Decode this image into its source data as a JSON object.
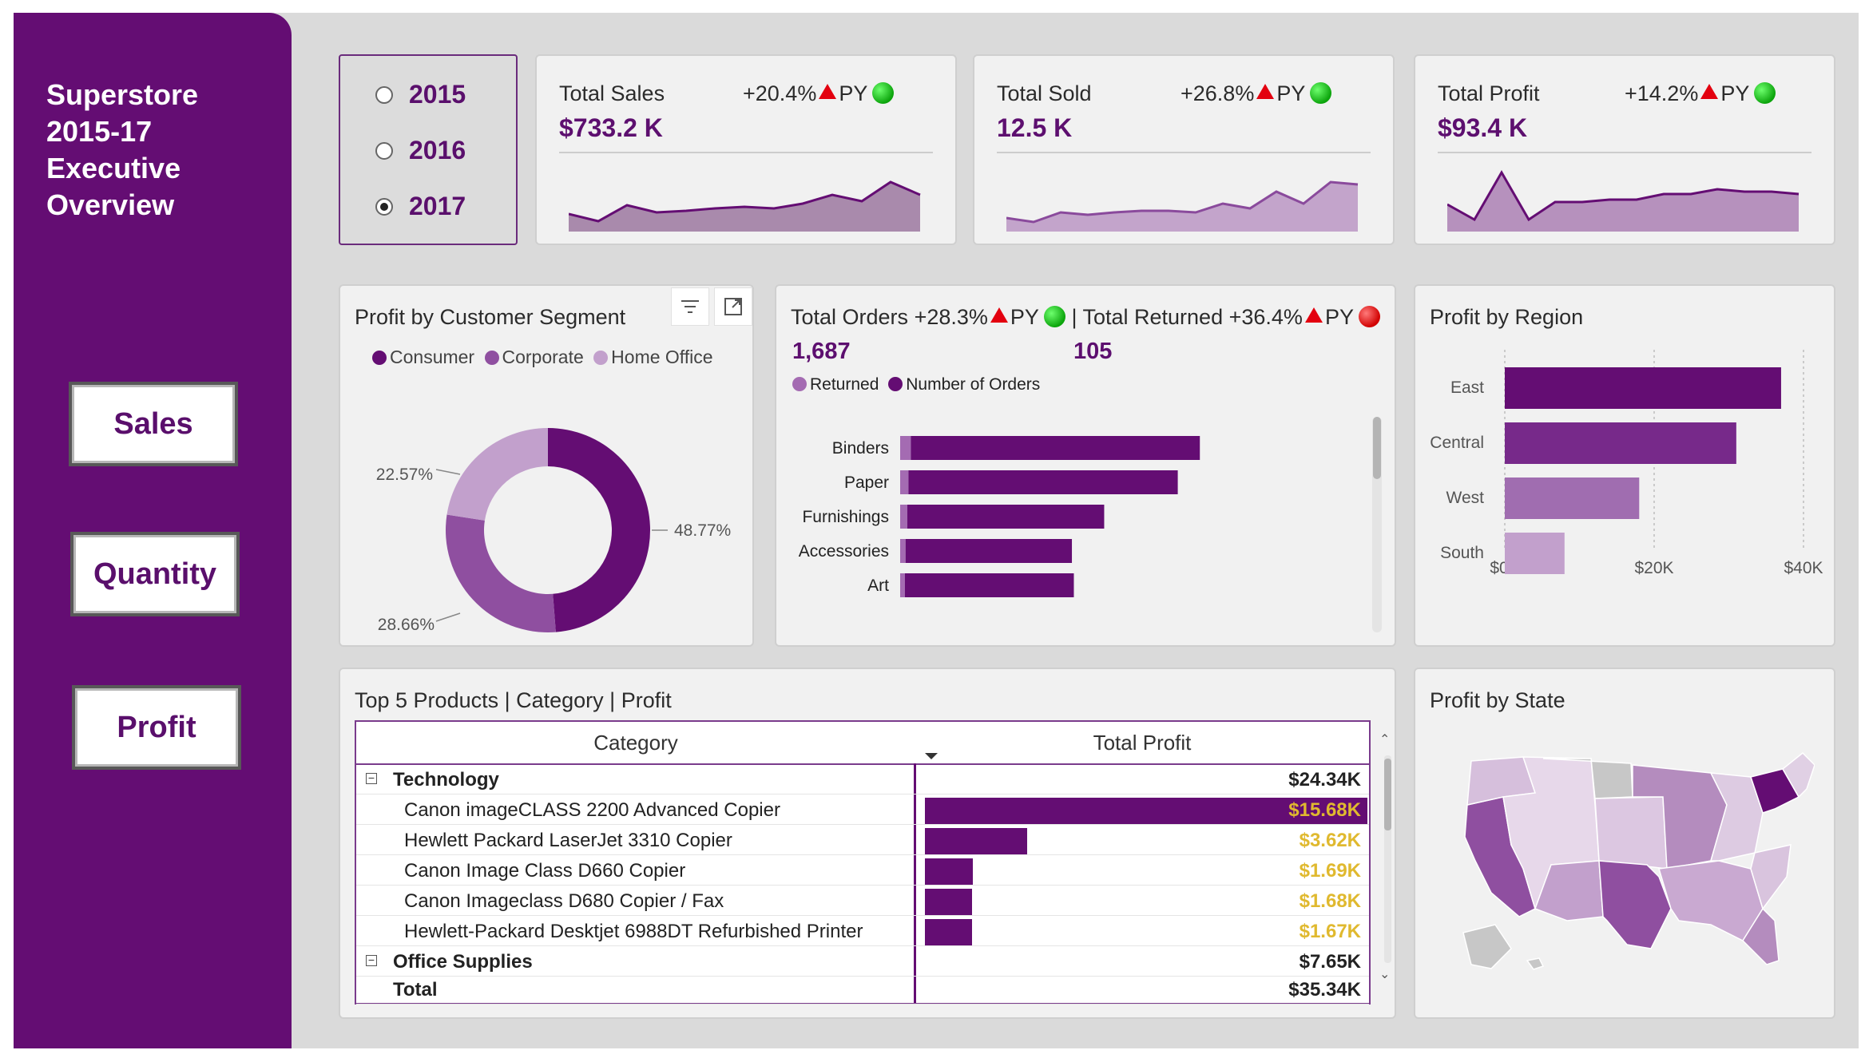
{
  "sidebar": {
    "title_lines": [
      "Superstore",
      "2015-17",
      "Executive",
      "Overview"
    ],
    "nav": [
      "Sales",
      "Quantity",
      "Profit"
    ]
  },
  "year_filter": {
    "options": [
      "2015",
      "2016",
      "2017"
    ],
    "selected": "2017"
  },
  "kpis": [
    {
      "label": "Total Sales",
      "value": "$733.2 K",
      "delta": "+20.4%",
      "suffix": "PY",
      "status": "green"
    },
    {
      "label": "Total Sold",
      "value": "12.5 K",
      "delta": "+26.8%",
      "suffix": "PY",
      "status": "green"
    },
    {
      "label": "Total Profit",
      "value": "$93.4 K",
      "delta": "+14.2%",
      "suffix": "PY",
      "status": "green"
    }
  ],
  "segment": {
    "title": "Profit by Customer Segment",
    "legend": [
      "Consumer",
      "Corporate",
      "Home Office"
    ],
    "labels": [
      "48.77%",
      "28.66%",
      "22.57%"
    ]
  },
  "orders": {
    "orders_label": "Total Orders",
    "orders_delta": "+28.3%",
    "orders_suffix": "PY",
    "separator": "|",
    "returned_label": "Total Returned",
    "returned_delta": "+36.4%",
    "returned_suffix": "PY",
    "orders_value": "1,687",
    "returned_value": "105",
    "legend": [
      "Returned",
      "Number of Orders"
    ],
    "categories": [
      "Binders",
      "Paper",
      "Furnishings",
      "Accessories",
      "Art"
    ]
  },
  "region": {
    "title": "Profit by Region",
    "categories": [
      "East",
      "Central",
      "West",
      "South"
    ],
    "ticks": [
      "$0K",
      "$20K",
      "$40K"
    ]
  },
  "top5": {
    "title": "Top 5 Products | Category | Profit",
    "col1": "Category",
    "col2": "Total Profit",
    "rows": [
      {
        "name": "Technology",
        "value": "$24.34K",
        "group": true
      },
      {
        "name": "Canon imageCLASS 2200 Advanced Copier",
        "value": "$15.68K"
      },
      {
        "name": "Hewlett Packard LaserJet 3310 Copier",
        "value": "$3.62K"
      },
      {
        "name": "Canon Image Class D660 Copier",
        "value": "$1.69K"
      },
      {
        "name": "Canon Imageclass D680 Copier / Fax",
        "value": "$1.68K"
      },
      {
        "name": "Hewlett-Packard Desktjet 6988DT Refurbished Printer",
        "value": "$1.67K"
      },
      {
        "name": "Office Supplies",
        "value": "$7.65K",
        "group": true
      },
      {
        "name": "Total",
        "value": "$35.34K",
        "total": true
      }
    ]
  },
  "state": {
    "title": "Profit by State"
  },
  "colors": {
    "brand": "#640d73",
    "mid": "#8f4fa0",
    "light": "#c2a0cc",
    "bg": "#dadada",
    "gold": "#e0b92f"
  },
  "chart_data": [
    {
      "type": "pie",
      "title": "Profit by Customer Segment",
      "categories": [
        "Consumer",
        "Corporate",
        "Home Office"
      ],
      "values": [
        48.77,
        28.66,
        22.57
      ]
    },
    {
      "type": "bar",
      "title": "",
      "categories": [
        "Binders",
        "Paper",
        "Furnishings",
        "Accessories",
        "Art"
      ],
      "series": [
        {
          "name": "Returned",
          "values": [
            18,
            14,
            12,
            9,
            8
          ]
        },
        {
          "name": "Number of Orders",
          "values": [
            455,
            424,
            310,
            262,
            266
          ]
        }
      ]
    },
    {
      "type": "bar",
      "title": "Profit by Region",
      "categories": [
        "East",
        "Central",
        "West",
        "South"
      ],
      "values": [
        37000,
        31000,
        18000,
        8000
      ],
      "xlim": [
        0,
        40000
      ]
    },
    {
      "type": "area",
      "title": "Total Sales",
      "values": [
        9,
        5,
        14,
        10,
        11,
        12,
        13,
        12,
        15,
        20,
        16,
        27,
        20
      ]
    },
    {
      "type": "area",
      "title": "Total Sold",
      "values": [
        10,
        7,
        15,
        13,
        15,
        16,
        16,
        15,
        22,
        18,
        32,
        22,
        40,
        38
      ]
    },
    {
      "type": "area",
      "title": "Total Profit",
      "values": [
        20,
        8,
        45,
        8,
        22,
        22,
        24,
        24,
        28,
        28,
        32,
        30,
        30,
        28
      ]
    },
    {
      "type": "bar",
      "title": "Top 5 Products | Category | Profit",
      "categories": [
        "Canon imageCLASS 2200 Advanced Copier",
        "Hewlett Packard LaserJet 3310 Copier",
        "Canon Image Class D660 Copier",
        "Canon Imageclass D680 Copier / Fax",
        "Hewlett-Packard Desktjet 6988DT Refurbished Printer"
      ],
      "values": [
        15.68,
        3.62,
        1.69,
        1.68,
        1.67
      ]
    }
  ]
}
